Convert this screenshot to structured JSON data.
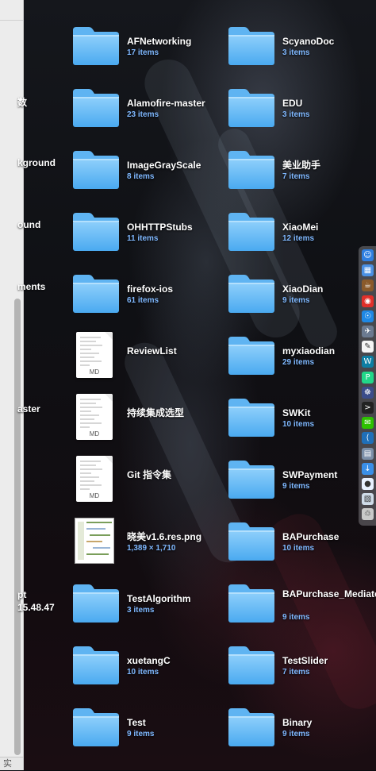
{
  "cut_labels": [
    "数",
    "kground",
    "ound",
    "ments",
    "aster",
    "pt",
    "15.48.47"
  ],
  "finder": {
    "bottom_label": "实"
  },
  "items_left": [
    {
      "kind": "folder",
      "name": "AFNetworking",
      "meta": "17 items"
    },
    {
      "kind": "folder",
      "name": "Alamofire-master",
      "meta": "23 items"
    },
    {
      "kind": "folder",
      "name": "ImageGrayScale",
      "meta": "8 items"
    },
    {
      "kind": "folder",
      "name": "OHHTTPStubs",
      "meta": "11 items"
    },
    {
      "kind": "folder",
      "name": "firefox-ios",
      "meta": "61 items"
    },
    {
      "kind": "doc",
      "name": "ReviewList",
      "meta": "",
      "tag": "MD"
    },
    {
      "kind": "doc",
      "name": "持续集成选型",
      "meta": "",
      "tag": "MD"
    },
    {
      "kind": "doc",
      "name": "Git 指令集",
      "meta": "",
      "tag": "MD"
    },
    {
      "kind": "image",
      "name": "晓美v1.6.res.png",
      "meta": "1,389 × 1,710"
    },
    {
      "kind": "folder",
      "name": "TestAlgorithm",
      "meta": "3 items"
    },
    {
      "kind": "folder",
      "name": "xuetangC",
      "meta": "10 items"
    },
    {
      "kind": "folder",
      "name": "Test",
      "meta": "9 items"
    }
  ],
  "items_right": [
    {
      "kind": "folder",
      "name": "ScyanoDoc",
      "meta": "3 items"
    },
    {
      "kind": "folder",
      "name": "EDU",
      "meta": "3 items"
    },
    {
      "kind": "folder",
      "name": "美业助手",
      "meta": "7 items"
    },
    {
      "kind": "folder",
      "name": "XiaoMei",
      "meta": "12 items"
    },
    {
      "kind": "folder",
      "name": "XiaoDian",
      "meta": "9 items"
    },
    {
      "kind": "folder",
      "name": "myxiaodian",
      "meta": "29 items"
    },
    {
      "kind": "folder",
      "name": "SWKit",
      "meta": "10 items"
    },
    {
      "kind": "folder",
      "name": "SWPayment",
      "meta": "9 items"
    },
    {
      "kind": "folder",
      "name": "BAPurchase",
      "meta": "10 items"
    },
    {
      "kind": "folder",
      "name": "BAPurchase_Mediator",
      "meta": "9 items"
    },
    {
      "kind": "folder",
      "name": "TestSlider",
      "meta": "7 items"
    },
    {
      "kind": "folder",
      "name": "Binary",
      "meta": "9 items"
    }
  ],
  "dock": [
    {
      "icon": "finder-icon",
      "color": "#2f7fe0",
      "glyph": "☺"
    },
    {
      "icon": "calendar-icon",
      "color": "#4a90e2",
      "glyph": "▦"
    },
    {
      "icon": "coffee-icon",
      "color": "#8a5a2b",
      "glyph": "☕"
    },
    {
      "icon": "weibo-icon",
      "color": "#e0302a",
      "glyph": "◉"
    },
    {
      "icon": "safari-icon",
      "color": "#1e88e5",
      "glyph": "☉"
    },
    {
      "icon": "launchpad-icon",
      "color": "#6b7a90",
      "glyph": "✈"
    },
    {
      "icon": "notes-icon",
      "color": "#f5f5f5",
      "glyph": "✎"
    },
    {
      "icon": "webstorm-icon",
      "color": "#0d7ea3",
      "glyph": "W"
    },
    {
      "icon": "pycharm-icon",
      "color": "#21d789",
      "glyph": "P"
    },
    {
      "icon": "network-icon",
      "color": "#3b4c8a",
      "glyph": "☸"
    },
    {
      "icon": "terminal-icon",
      "color": "#222222",
      "glyph": ">"
    },
    {
      "icon": "wechat-icon",
      "color": "#2dc100",
      "glyph": "✉"
    },
    {
      "icon": "vscode-icon",
      "color": "#1f6fb8",
      "glyph": "⟨"
    },
    {
      "icon": "photos-icon",
      "color": "#7b8fa8",
      "glyph": "▤"
    },
    {
      "icon": "downloads-icon",
      "color": "#3a8fe8",
      "glyph": "↓"
    },
    {
      "icon": "qq-icon",
      "color": "#e8f1ff",
      "glyph": "●"
    },
    {
      "icon": "preview-icon",
      "color": "#cfdbe8",
      "glyph": "▧"
    },
    {
      "icon": "trash-icon",
      "color": "#c9c9c9",
      "glyph": "♲"
    }
  ]
}
